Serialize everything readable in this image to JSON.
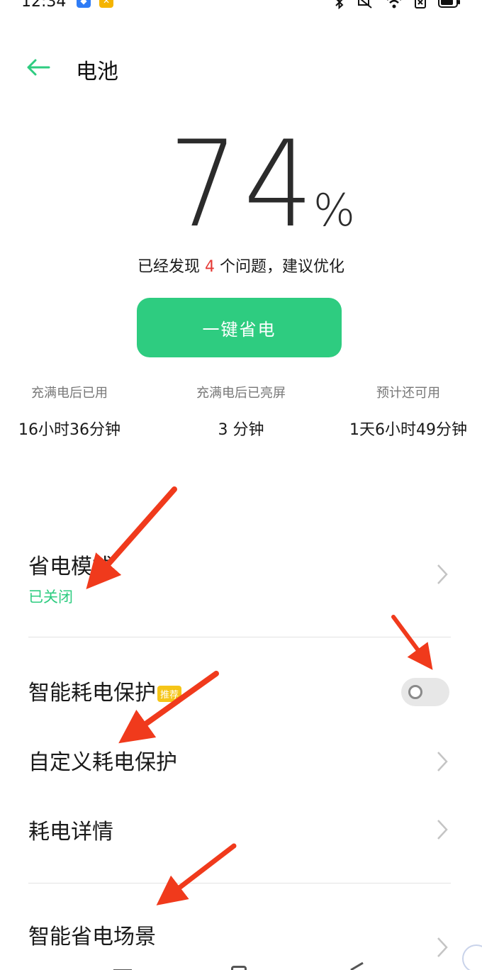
{
  "status_bar": {
    "time": "12:34",
    "icons": [
      "app-icon-blue",
      "app-icon-yellow",
      "bluetooth-icon",
      "mute-icon",
      "wifi-icon",
      "sim-icon",
      "battery-icon"
    ]
  },
  "header": {
    "back_icon": "back-arrow-icon",
    "title": "电池"
  },
  "battery": {
    "level": "74",
    "unit": "%"
  },
  "issues": {
    "prefix": "已经发现 ",
    "count": "4",
    "suffix": " 个问题，建议优化"
  },
  "optimize_button": {
    "label": "一键省电"
  },
  "stats": [
    {
      "label": "充满电后已用",
      "value": "16小时36分钟"
    },
    {
      "label": "充满电后已亮屏",
      "value": "3 分钟"
    },
    {
      "label": "预计还可用",
      "value": "1天6小时49分钟"
    }
  ],
  "settings": {
    "power_mode": {
      "title": "省电模式",
      "status": "已关闭"
    },
    "smart_protection": {
      "title": "智能耗电保护",
      "badge": "推荐",
      "enabled": false
    },
    "custom_protection": {
      "title": "自定义耗电保护"
    },
    "usage_details": {
      "title": "耗电详情"
    },
    "smart_scenes": {
      "title": "智能省电场景"
    }
  },
  "colors": {
    "accent": "#2ecc80",
    "warning": "#e53935",
    "badge": "#f5c518",
    "annotation": "#f03a1c"
  }
}
